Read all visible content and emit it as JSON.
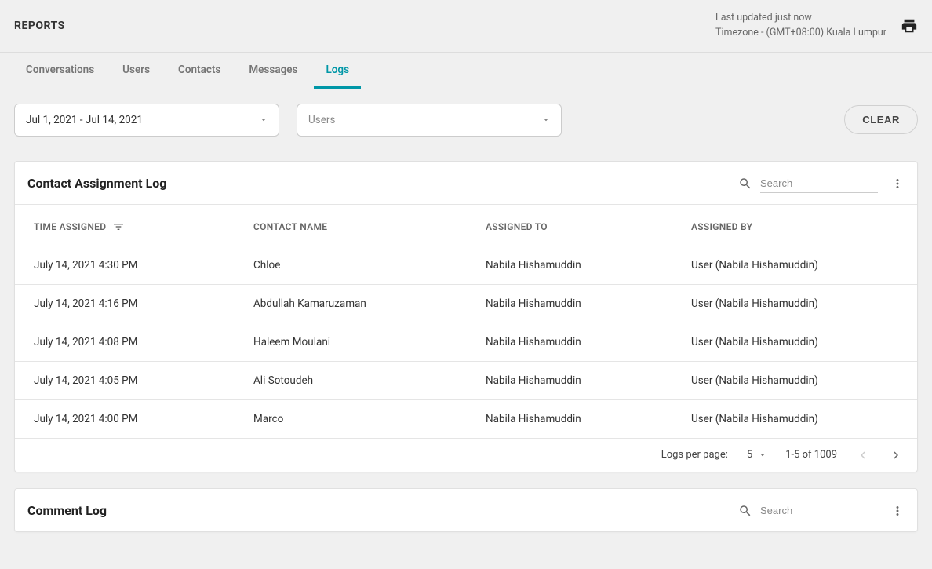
{
  "header": {
    "title": "REPORTS",
    "last_updated": "Last updated just now",
    "timezone": "Timezone - (GMT+08:00) Kuala Lumpur"
  },
  "tabs": [
    {
      "label": "Conversations",
      "active": false
    },
    {
      "label": "Users",
      "active": false
    },
    {
      "label": "Contacts",
      "active": false
    },
    {
      "label": "Messages",
      "active": false
    },
    {
      "label": "Logs",
      "active": true
    }
  ],
  "filters": {
    "date_range": "Jul 1, 2021 - Jul 14, 2021",
    "users_placeholder": "Users",
    "clear_label": "CLEAR"
  },
  "contact_log": {
    "title": "Contact Assignment Log",
    "search_placeholder": "Search",
    "columns": {
      "time": "TIME ASSIGNED",
      "contact": "CONTACT NAME",
      "assigned_to": "ASSIGNED TO",
      "assigned_by": "ASSIGNED BY"
    },
    "rows": [
      {
        "time": "July 14, 2021 4:30 PM",
        "contact": "Chloe",
        "assigned_to": "Nabila Hishamuddin",
        "assigned_by": "User (Nabila Hishamuddin)"
      },
      {
        "time": "July 14, 2021 4:16 PM",
        "contact": "Abdullah Kamaruzaman",
        "assigned_to": "Nabila Hishamuddin",
        "assigned_by": "User (Nabila Hishamuddin)"
      },
      {
        "time": "July 14, 2021 4:08 PM",
        "contact": "Haleem Moulani",
        "assigned_to": "Nabila Hishamuddin",
        "assigned_by": "User (Nabila Hishamuddin)"
      },
      {
        "time": "July 14, 2021 4:05 PM",
        "contact": "Ali Sotoudeh",
        "assigned_to": "Nabila Hishamuddin",
        "assigned_by": "User (Nabila Hishamuddin)"
      },
      {
        "time": "July 14, 2021 4:00 PM",
        "contact": "Marco",
        "assigned_to": "Nabila Hishamuddin",
        "assigned_by": "User (Nabila Hishamuddin)"
      }
    ],
    "pagination": {
      "per_page_label": "Logs per page:",
      "per_page_value": "5",
      "range": "1-5 of 1009"
    }
  },
  "comment_log": {
    "title": "Comment Log",
    "search_placeholder": "Search"
  }
}
